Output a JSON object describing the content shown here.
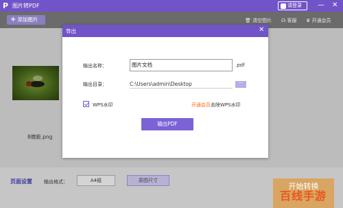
{
  "app": {
    "logo": "P",
    "title": "图片转PDF"
  },
  "titlebar": {
    "login": "请登录",
    "minimize": "—",
    "close": "✕"
  },
  "toolbar": {
    "add_label": "添加图片",
    "clear": "清空图片",
    "service": "客服",
    "vip": "开通会员"
  },
  "files": [
    {
      "name": "8微距.png"
    }
  ],
  "dialog": {
    "title": "导出",
    "close": "✕",
    "name_label": "输出名称：",
    "name_value": "图片文档",
    "ext": ".pdf",
    "dir_label": "输出目录：",
    "dir_value": "C:\\Users\\admin\\Desktop",
    "browse": "···",
    "wps_label": "WPS水印",
    "wps_checked": true,
    "vip_link": "开通会员",
    "vip_suffix": "去除WPS水印",
    "export_label": "输出PDF"
  },
  "footer": {
    "page_setup": "页面设置",
    "format_label": "输出格式：",
    "format_value": "A4纸",
    "size_button": "原图尺寸",
    "start_button": "开始转换"
  },
  "watermark": "百线手游",
  "colors": {
    "accent": "#7154c7",
    "vip": "#ff6a00",
    "start": "#d9a562"
  }
}
